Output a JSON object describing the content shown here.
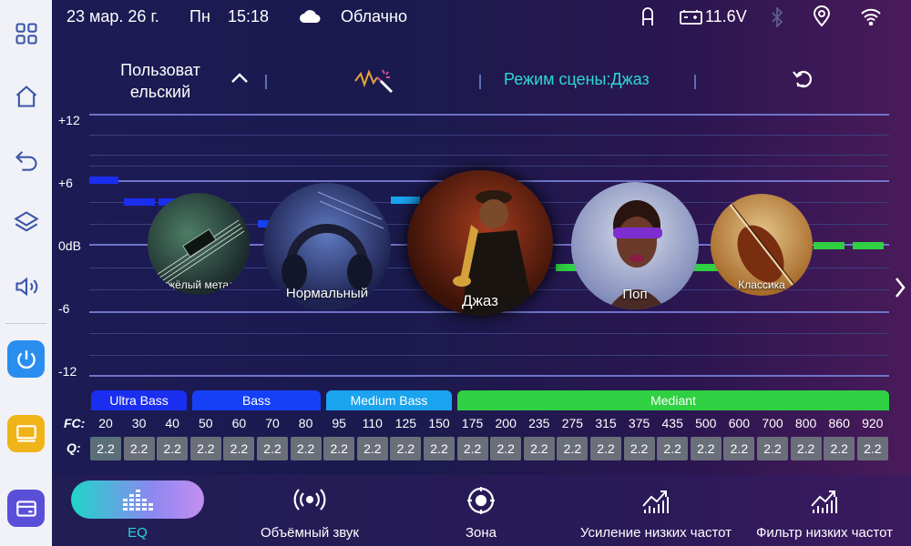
{
  "status": {
    "date": "23 мар. 26 г.",
    "weekday": "Пн",
    "time": "15:18",
    "weather": "Облачно",
    "voltage": "11.6V"
  },
  "header": {
    "preset_name": "Пользоват\nельский",
    "scene_mode": "Режим сцены:Джаз"
  },
  "graph": {
    "labels": [
      "+12",
      "+6",
      "0dB",
      "-6",
      "-12"
    ]
  },
  "presets": [
    {
      "label": "Тяжёлый металл"
    },
    {
      "label": "Нормальный"
    },
    {
      "label": "Джаз"
    },
    {
      "label": "Поп"
    },
    {
      "label": "Классика"
    }
  ],
  "bands": [
    {
      "label": "Ultra Bass",
      "color": "#1a2ef0"
    },
    {
      "label": "Bass",
      "color": "#1540f5"
    },
    {
      "label": "Medium Bass",
      "color": "#1aa3ee"
    },
    {
      "label": "Mediant",
      "color": "#2fd042"
    }
  ],
  "fc_label": "FC:",
  "q_label": "Q:",
  "fc_values": [
    "20",
    "30",
    "40",
    "50",
    "60",
    "70",
    "80",
    "95",
    "110",
    "125",
    "150",
    "175",
    "200",
    "235",
    "275",
    "315",
    "375",
    "435",
    "500",
    "600",
    "700",
    "800",
    "860",
    "920"
  ],
  "q_values": [
    "2.2",
    "2.2",
    "2.2",
    "2.2",
    "2.2",
    "2.2",
    "2.2",
    "2.2",
    "2.2",
    "2.2",
    "2.2",
    "2.2",
    "2.2",
    "2.2",
    "2.2",
    "2.2",
    "2.2",
    "2.2",
    "2.2",
    "2.2",
    "2.2",
    "2.2",
    "2.2",
    "2.2"
  ],
  "tabs": [
    {
      "label": "EQ",
      "active": true
    },
    {
      "label": "Объёмный звук"
    },
    {
      "label": "Зона"
    },
    {
      "label": "Усиление низких частот"
    },
    {
      "label": "Фильтр низких частот"
    }
  ],
  "icons": {
    "sidebar": [
      "grid-icon",
      "home-icon",
      "back-icon",
      "layers-icon",
      "volume-icon",
      "power-icon",
      "screen-icon",
      "settings-tile-icon"
    ],
    "status": [
      "cloud-icon",
      "user-icon",
      "battery-icon",
      "bluetooth-icon",
      "location-icon",
      "wifi-icon"
    ],
    "header": [
      "chevron-up-icon",
      "magic-wand-icon",
      "reset-icon"
    ],
    "next": "chevron-right-icon"
  },
  "colors": {
    "accent_teal": "#2fd7d6",
    "band_ultra_bass": "#1a2ef0",
    "band_bass": "#1540f5",
    "band_medium_bass": "#1aa3ee",
    "band_mediant": "#2fd042"
  }
}
